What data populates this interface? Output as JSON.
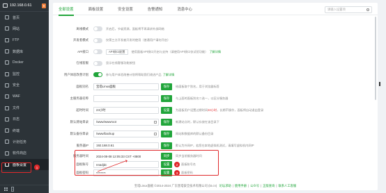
{
  "sidebar": {
    "ip": "192.168.0.61",
    "badge": "8",
    "items": [
      {
        "label": "首页",
        "icon": "home-icon"
      },
      {
        "label": "网站",
        "icon": "globe-icon"
      },
      {
        "label": "FTP",
        "icon": "ftp-icon"
      },
      {
        "label": "数据库",
        "icon": "database-icon"
      },
      {
        "label": "Docker",
        "icon": "docker-icon"
      },
      {
        "label": "监控",
        "icon": "monitor-icon"
      },
      {
        "label": "安全",
        "icon": "shield-icon"
      },
      {
        "label": "WAF",
        "icon": "waf-icon"
      },
      {
        "label": "文件",
        "icon": "folder-icon"
      },
      {
        "label": "日志",
        "icon": "log-icon"
      },
      {
        "label": "终端",
        "icon": "terminal-icon"
      },
      {
        "label": "计划任务",
        "icon": "clock-icon"
      },
      {
        "label": "软件商店",
        "icon": "store-icon"
      },
      {
        "label": "面板设置",
        "icon": "settings-icon"
      }
    ],
    "active_index": 13,
    "annot_1": "1",
    "footer_count": "1"
  },
  "tabs": [
    "全部设置",
    "面板设置",
    "安全设置",
    "告警通知",
    "消息中心"
  ],
  "active_tab": 0,
  "search": {
    "placeholder": "请输入设置项"
  },
  "toggles": [
    {
      "label": "离线模式",
      "on": false,
      "desc": "开启后，节省资源，面板将不再请求外部网络"
    },
    {
      "label": "开发者模式",
      "on": false,
      "desc": "仅第三方开发者开发时使用（普通用户请勿开启）"
    },
    {
      "label": "API接口",
      "on": false,
      "button": "API接口配置",
      "desc": "使用面板API接口开启与支持（请使用API接口仅试验功能）",
      "link": "了解详情"
    },
    {
      "label": "在线客服",
      "on": false,
      "desc": "显示在线客服功能按钮"
    },
    {
      "label": "用户体验改善计划",
      "on": true,
      "desc": "参与用户体验改善计划将帮助我们改进产品",
      "link": "了解详情"
    }
  ],
  "fields": [
    {
      "label": "面板别名",
      "value": "宝塔Linux面板",
      "btn": "保存",
      "desc": "给面板取个别名，用于浏览器标签"
    },
    {
      "label": "主服务器名称",
      "value": "",
      "btn": "保存",
      "desc": "与上面的面板别名二选一，以区分服务器"
    },
    {
      "label": "超时时间",
      "value": "24小时",
      "btn": "设置",
      "desc": "为面板用户设置过期时间",
      "desc_red": "24小时",
      "desc_tail": "，长期不操作，面板将自动退出登录"
    },
    {
      "label": "默认建站目录",
      "value": "/www/wwwroot",
      "btn": "保存",
      "desc": "新建站点时，默认存放在该目录下"
    },
    {
      "label": "默认备份目录",
      "value": "/www/backup",
      "btn": "保存",
      "desc": "网站和数据库的默认备份目录"
    },
    {
      "label": "服务器IP",
      "value": "192.168.0.61",
      "btn": "保存",
      "desc": "默认为外网IP，若您在本地虚拟机测试，请填写虚拟机内网IP"
    },
    {
      "label": "服务器时间",
      "value": "2024-08-08 12:05:33 CST +0800",
      "btn": "同步",
      "desc": "同步当前服务器时间"
    },
    {
      "label": "面板账号",
      "value": "nnadjdc",
      "btn": "设置",
      "desc": "面板账号名",
      "annot": "2"
    },
    {
      "label": "面板密码",
      "value": "********",
      "btn": "设置",
      "desc": "面板密码",
      "annot": "3"
    }
  ],
  "footer": {
    "copyright": "宝塔Linux面板 ©2014-2024 广东堡塔安全技术有限公司 (bt.cn)",
    "links": [
      "论坛求助",
      "使用手册",
      "公众号",
      "正版查询",
      "联系人工客服"
    ]
  },
  "colors": {
    "accent": "#20a53a",
    "sidebar": "#2c3338",
    "highlight": "#e0292b"
  }
}
